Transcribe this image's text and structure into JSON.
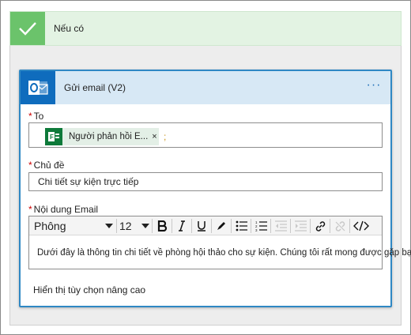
{
  "condition": {
    "title": "Nếu có",
    "icon": "checkmark-icon"
  },
  "action": {
    "title": "Gửi email (V2)",
    "icon": "outlook-icon",
    "more_label": "···"
  },
  "fields": {
    "to": {
      "label": "To",
      "required_mark": "*",
      "token_label": "Người phản hồi E...",
      "token_remove": "×",
      "token_icon": "forms-icon",
      "separator": ";"
    },
    "subject": {
      "label": "Chủ đề",
      "required_mark": "*",
      "value": "Chi tiết sự kiện trực tiếp"
    },
    "body": {
      "label": "Nội dung Email",
      "required_mark": "*",
      "font": "Phông",
      "font_size": "12",
      "value": "Dưới đây là thông tin chi tiết về phòng hội thảo cho sự kiện. Chúng tôi rất mong được gặp bạn."
    }
  },
  "toolbar_icons": [
    "bold-icon",
    "italic-icon",
    "underline-icon",
    "pen-icon",
    "bulleted-list-icon",
    "numbered-list-icon",
    "decrease-indent-icon",
    "increase-indent-icon",
    "link-icon",
    "unlink-icon",
    "code-view-icon"
  ],
  "advanced_options": "Hiển thị tùy chọn nâng cao",
  "colors": {
    "condition_green": "#6bc36b",
    "condition_header_bg": "#e3f3e3",
    "action_blue": "#2f88c4",
    "outlook_blue": "#0f6cbd",
    "forms_green": "#0e7a3a",
    "required_red": "#cc0000"
  }
}
